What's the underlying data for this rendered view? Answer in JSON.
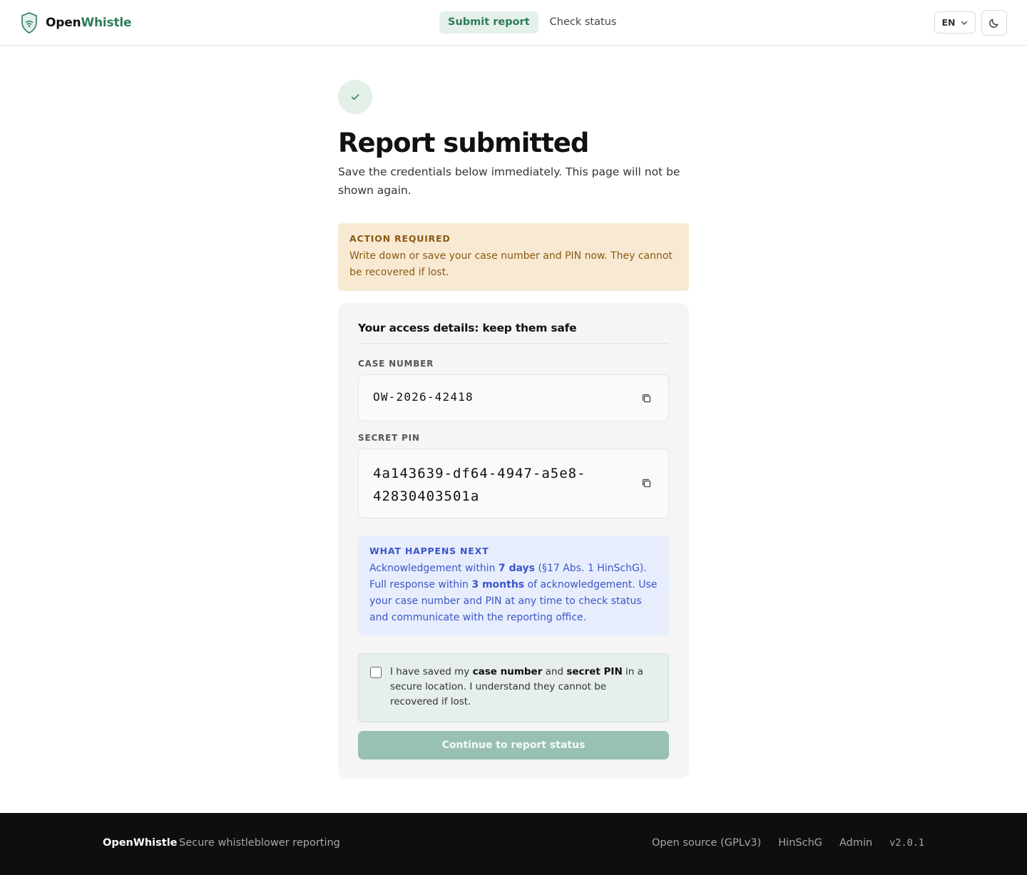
{
  "header": {
    "logo_part1": "Open",
    "logo_part2": "Whistle",
    "logo_icon": "shield-wifi-icon",
    "nav": {
      "submit_report": "Submit report",
      "check_status": "Check status"
    },
    "language": "EN",
    "theme_icon": "moon-icon"
  },
  "main": {
    "title": "Report submitted",
    "subtitle": "Save the credentials below immediately. This page will not be shown again.",
    "warning": {
      "title": "ACTION REQUIRED",
      "body": "Write down or save your case number and PIN now. They cannot be recovered if lost."
    },
    "card": {
      "title": "Your access details: keep them safe",
      "case_number_label": "CASE NUMBER",
      "case_number": "OW-2026-42418",
      "pin_label": "SECRET PIN",
      "pin_line1": "4a143639-df64-4947-a5e8-",
      "pin_line2": "42830403501a",
      "info": {
        "title": "WHAT HAPPENS NEXT",
        "t1": "Acknowledgement within ",
        "b1": "7 days",
        "t2": " (§17 Abs. 1 HinSchG). Full response within ",
        "b2": "3 months",
        "t3": " of acknowledgement. Use your case number and PIN at any time to check status and communicate with the reporting office."
      },
      "confirm": {
        "t1": "I have saved my ",
        "b1": "case number",
        "t2": " and ",
        "b2": "secret PIN",
        "t3": " in a secure location. I understand they cannot be recovered if lost."
      },
      "continue_label": "Continue to report status"
    }
  },
  "footer": {
    "brand": "OpenWhistle",
    "tagline": "Secure whistleblower reporting",
    "links": {
      "open_source": "Open source (GPLv3)",
      "hinschg": "HinSchG",
      "admin": "Admin"
    },
    "version": "v2.0.1"
  },
  "colors": {
    "accent": "#2f7a5a",
    "warning_bg": "#f8e9d2",
    "info_bg": "#e7edfd",
    "button_disabled": "#99c1b1"
  }
}
